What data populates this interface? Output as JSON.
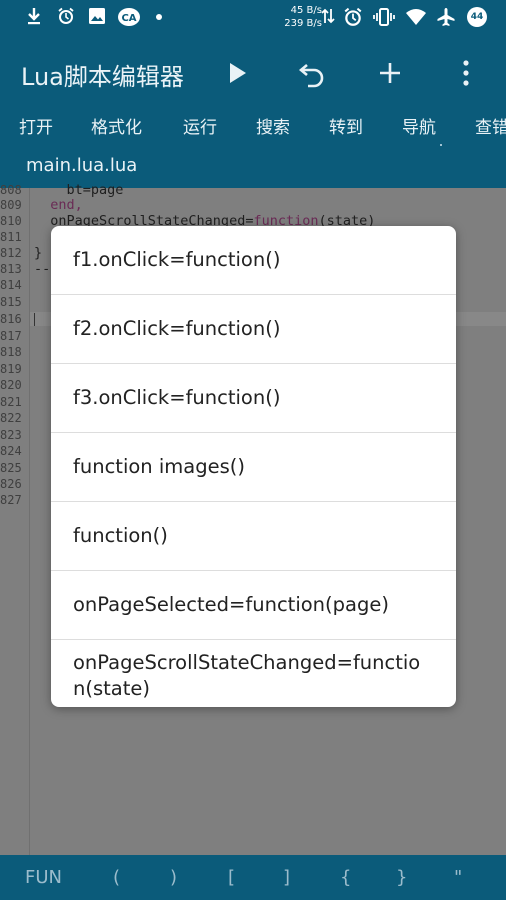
{
  "status_bar": {
    "net_speed_up": "45 B/s",
    "net_speed_down": "239 B/s",
    "battery_level": "44",
    "icons": [
      "download-icon",
      "alarm-icon",
      "image-icon",
      "cloud-app-icon",
      "dot-icon",
      "data-arrows-icon",
      "alarm-icon",
      "vibrate-icon",
      "wifi-icon",
      "airplane-icon",
      "battery-icon"
    ]
  },
  "app_bar": {
    "title": "Lua脚本编辑器",
    "actions": [
      "play-icon",
      "undo-icon",
      "add-icon",
      "overflow-menu-icon"
    ],
    "menu": [
      "打开",
      "格式化",
      "运行",
      "搜索",
      "转到",
      "导航",
      "查错"
    ],
    "file_tab": "main.lua.lua"
  },
  "editor": {
    "line_numbers": [
      "808",
      "809",
      "810",
      "811",
      "812",
      "813",
      "814",
      "815",
      "816",
      "817",
      "818",
      "819",
      "820",
      "821",
      "822",
      "823",
      "824",
      "825",
      "826",
      "827"
    ],
    "visible_code": {
      "l808": "    bt=page",
      "l809": "  end,",
      "l810_prefix": "  onPageScrollStateChanged=",
      "l810_kw": "function",
      "l810_suffix": "(state)",
      "l812": "}",
      "l813": "--"
    }
  },
  "dialog": {
    "items": [
      "f1.onClick=function()",
      "f2.onClick=function()",
      "f3.onClick=function()",
      "function images()",
      "function()",
      "onPageSelected=function(page)",
      "onPageScrollStateChanged=function(state)"
    ],
    "last_item_line1": "onPageScrollStateChanged=functio",
    "last_item_line2": "n(state)"
  },
  "symbol_bar": [
    "FUN",
    "(",
    ")",
    "[",
    "]",
    "{",
    "}",
    "\""
  ],
  "colors": {
    "app_bar": "#0b5b7a",
    "scrim": "#7f7f7f",
    "dialog": "#ffffff"
  }
}
